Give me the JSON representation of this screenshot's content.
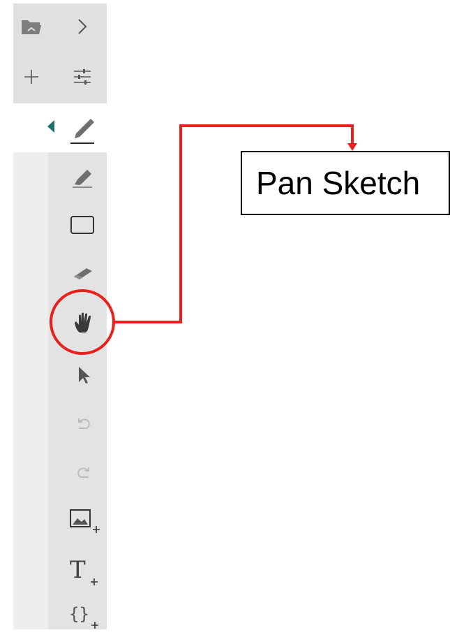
{
  "callout": {
    "label": "Pan Sketch",
    "color": "#e8211d"
  },
  "toolbar": {
    "top": [
      "folder-open-icon",
      "expand-chevron-icon",
      "add-icon",
      "settings-sliders-icon"
    ],
    "active_tool": "pen-icon",
    "tools": [
      "pen-icon",
      "highlighter-icon",
      "rectangle-icon",
      "eraser-icon",
      "pan-hand-icon",
      "select-pointer-icon",
      "undo-icon",
      "redo-icon",
      "insert-image-icon",
      "insert-text-icon",
      "insert-code-icon"
    ]
  },
  "accent_color": "#1f6f6d"
}
